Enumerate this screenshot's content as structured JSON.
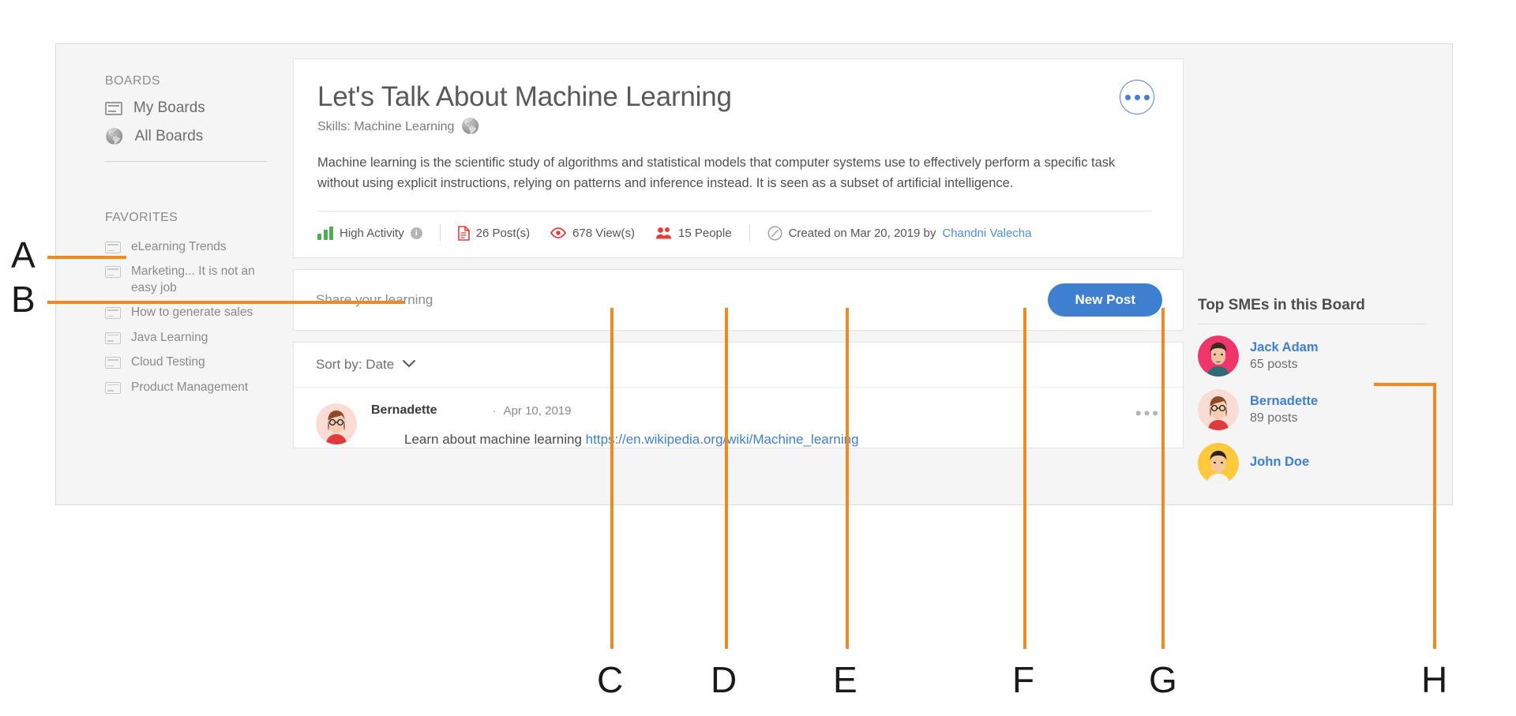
{
  "sidebar": {
    "boards_heading": "BOARDS",
    "items": [
      {
        "label": "My Boards",
        "icon": "boards-icon"
      },
      {
        "label": "All Boards",
        "icon": "globe-icon"
      }
    ],
    "favorites_heading": "FAVORITES",
    "favorites": [
      {
        "label": "eLearning Trends"
      },
      {
        "label": "Marketing... It is not an easy job"
      },
      {
        "label": "How to generate sales"
      },
      {
        "label": "Java Learning"
      },
      {
        "label": "Cloud Testing"
      },
      {
        "label": "Product Management"
      }
    ]
  },
  "board": {
    "title": "Let's Talk About Machine Learning",
    "skills_label": "Skills: Machine Learning",
    "skills_icon": "globe-icon",
    "description": "Machine learning is the scientific study of algorithms and statistical models that computer systems use to effectively perform a specific task without using explicit instructions, relying on patterns and inference instead. It is seen as a subset of artificial intelligence.",
    "menu_icon": "ellipsis-icon",
    "stats": {
      "activity_label": "High Activity",
      "activity_info_icon": "info-icon",
      "activity_icon": "bar-chart-icon",
      "posts_label": "26 Post(s)",
      "posts_icon": "document-icon",
      "views_label": "678 View(s)",
      "views_icon": "eye-icon",
      "people_label": "15 People",
      "people_icon": "people-icon",
      "created_icon": "clock-icon",
      "created_label": "Created on Mar 20, 2019 by",
      "created_by": "Chandni Valecha"
    }
  },
  "share": {
    "placeholder": "Share your learning",
    "new_post_label": "New Post"
  },
  "feed": {
    "sort_label": "Sort by: Date",
    "sort_chevron": "chevron-down-icon",
    "posts": [
      {
        "author": "Bernadette",
        "separator": "·",
        "date": "Apr 10, 2019",
        "text": "Learn about machine learning ",
        "link": "https://en.wikipedia.org/wiki/Machine_learning",
        "menu_icon": "ellipsis-icon"
      }
    ]
  },
  "rail": {
    "title": "Top SMEs in this Board",
    "smes": [
      {
        "name": "Jack Adam",
        "posts": "65 posts",
        "bg": "#f0356a",
        "hair": "#3a2a20",
        "shirt": "#2d6b75",
        "skin": "#f3c3a0"
      },
      {
        "name": "Bernadette",
        "posts": "89 posts",
        "bg": "#fbdcd5",
        "hair": "#8d4a28",
        "shirt": "#e03a3a",
        "skin": "#f6cdb0"
      },
      {
        "name": "John Doe",
        "posts": "",
        "bg": "#ffc83d",
        "hair": "#2f2218",
        "shirt": "#f4f4f4",
        "skin": "#f5c79d"
      }
    ]
  },
  "annotations": {
    "color": "#f08a20",
    "labels": [
      {
        "id": "A",
        "text": "A"
      },
      {
        "id": "B",
        "text": "B"
      },
      {
        "id": "C",
        "text": "C"
      },
      {
        "id": "D",
        "text": "D"
      },
      {
        "id": "E",
        "text": "E"
      },
      {
        "id": "F",
        "text": "F"
      },
      {
        "id": "G",
        "text": "G"
      },
      {
        "id": "H",
        "text": "H"
      }
    ]
  },
  "colors": {
    "accent_blue": "#3f7fd0",
    "annotation_orange": "#f08a20",
    "activity_green": "#4caf4f",
    "stat_red": "#ec3a35",
    "link_blue": "#3e7fd4"
  }
}
